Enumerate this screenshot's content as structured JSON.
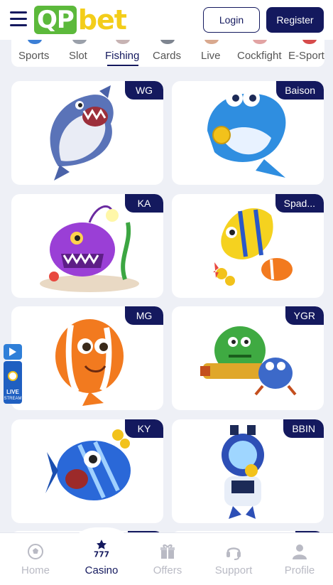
{
  "header": {
    "logo_qp": "QP",
    "logo_bet": "bet",
    "login_label": "Login",
    "register_label": "Register"
  },
  "tabs": [
    {
      "label": "Sports",
      "icon": "sports-icon"
    },
    {
      "label": "Slot",
      "icon": "slot-icon"
    },
    {
      "label": "Fishing",
      "icon": "fishing-icon",
      "active": true
    },
    {
      "label": "Cards",
      "icon": "cards-icon"
    },
    {
      "label": "Live",
      "icon": "live-icon"
    },
    {
      "label": "Cockfight",
      "icon": "cockfight-icon"
    },
    {
      "label": "E-Sport",
      "icon": "esport-icon"
    }
  ],
  "games": [
    {
      "provider": "WG",
      "art": "white-shark"
    },
    {
      "provider": "Baison",
      "art": "blue-shark-coin"
    },
    {
      "provider": "KA",
      "art": "purple-anglerfish"
    },
    {
      "provider": "Spad...",
      "art": "yellow-angelfish-clownfish"
    },
    {
      "provider": "MG",
      "art": "orange-clownfish"
    },
    {
      "provider": "YGR",
      "art": "green-monster-crab"
    },
    {
      "provider": "KY",
      "art": "blue-striped-fish"
    },
    {
      "provider": "BBIN",
      "art": "robot-diver"
    }
  ],
  "live_stream": {
    "line1": "LIVE",
    "line2": "STREAM"
  },
  "bottom_nav": [
    {
      "label": "Home",
      "icon": "soccer-ball-icon"
    },
    {
      "label": "Casino",
      "icon": "casino-777-icon",
      "active": true
    },
    {
      "label": "Offers",
      "icon": "gift-icon"
    },
    {
      "label": "Support",
      "icon": "headset-icon"
    },
    {
      "label": "Profile",
      "icon": "user-icon"
    }
  ],
  "colors": {
    "brand_navy": "#14195e",
    "logo_green": "#5cb93b",
    "logo_yellow": "#f3cd1a",
    "inactive_gray": "#b9bac4"
  }
}
